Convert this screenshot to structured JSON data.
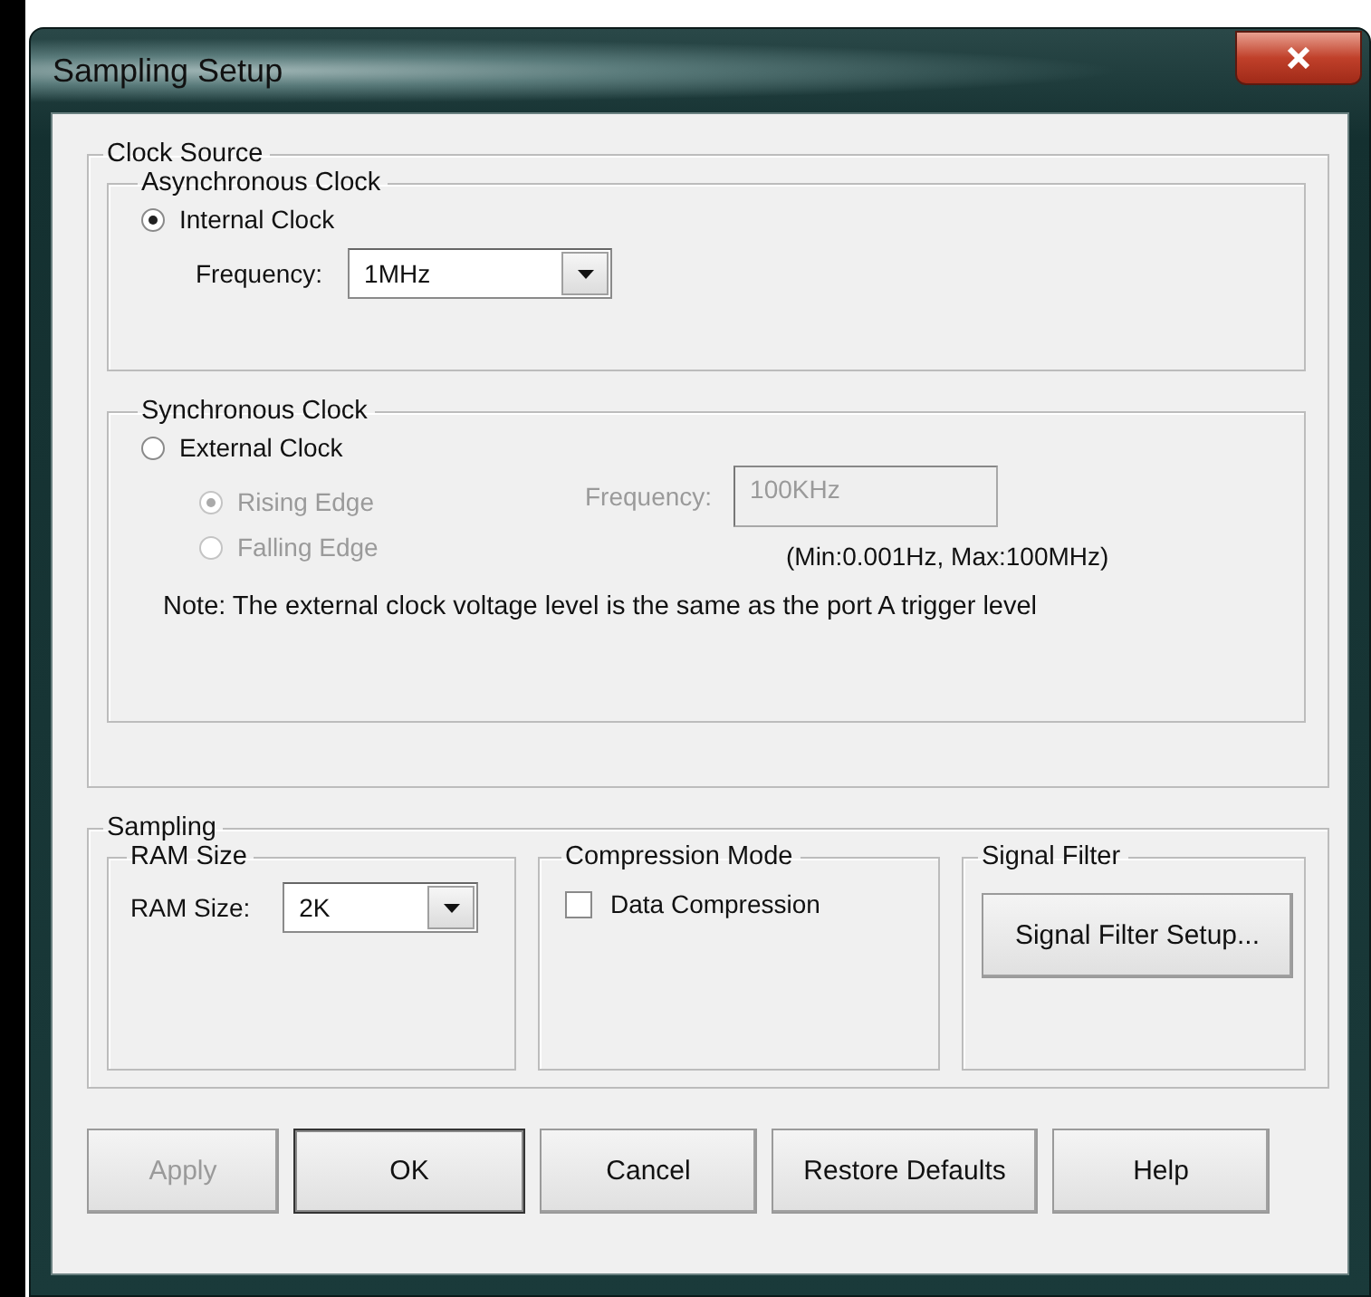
{
  "window": {
    "title": "Sampling Setup"
  },
  "clock_source": {
    "title": "Clock Source",
    "async": {
      "title": "Asynchronous Clock",
      "radio": {
        "label": "Internal Clock",
        "selected": true,
        "disabled": false
      },
      "frequency": {
        "label": "Frequency:",
        "value": "1MHz",
        "disabled": false
      }
    },
    "sync": {
      "title": "Synchronous Clock",
      "radio": {
        "label": "External Clock",
        "selected": false,
        "disabled": false
      },
      "edges": [
        {
          "label": "Rising Edge",
          "selected": true,
          "disabled": true
        },
        {
          "label": "Falling Edge",
          "selected": false,
          "disabled": true
        }
      ],
      "frequency": {
        "label": "Frequency:",
        "value": "100KHz",
        "disabled": true
      },
      "range": "(Min:0.001Hz, Max:100MHz)",
      "note": "Note: The external clock voltage level is the same as the port A trigger level"
    }
  },
  "sampling": {
    "title": "Sampling",
    "ram": {
      "title": "RAM Size",
      "label": "RAM Size:",
      "value": "2K"
    },
    "compression": {
      "title": "Compression Mode",
      "checkbox": {
        "label": "Data Compression",
        "checked": false
      }
    },
    "filter": {
      "title": "Signal Filter",
      "button": "Signal Filter Setup..."
    }
  },
  "buttons": [
    {
      "label": "Apply",
      "disabled": true,
      "default": false
    },
    {
      "label": "OK",
      "disabled": false,
      "default": true
    },
    {
      "label": "Cancel",
      "disabled": false,
      "default": false
    },
    {
      "label": "Restore Defaults",
      "disabled": false,
      "default": false
    },
    {
      "label": "Help",
      "disabled": false,
      "default": false
    }
  ]
}
